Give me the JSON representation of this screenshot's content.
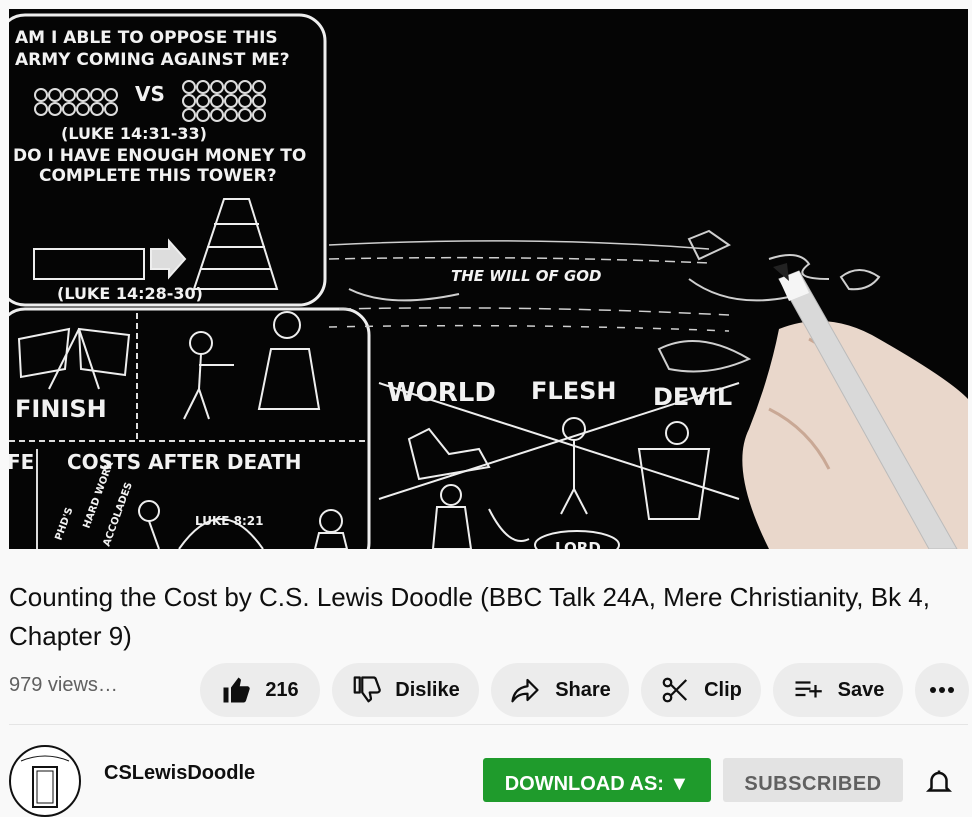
{
  "video": {
    "bubble_top_text1": "AM I ABLE TO OPPOSE THIS",
    "bubble_top_text2": "ARMY COMING AGAINST ME?",
    "bubble_vs": "VS",
    "bubble_top_ref": "(LUKE 14:31-33)",
    "bubble_mid_text1": "DO I HAVE ENOUGH MONEY TO",
    "bubble_mid_text2": "COMPLETE THIS TOWER?",
    "bubble_mid_ref": "(LUKE 14:28-30)",
    "finish_label": "FINISH",
    "costs_label": "COSTS AFTER DEATH",
    "river_label": "THE WILL OF GOD",
    "world_label": "WORLD",
    "flesh_label": "FLESH",
    "devil_label": "DEVIL",
    "lord_label": "LORD",
    "luke_label": "LUKE 8:21",
    "side_label_1": "PHD'S",
    "side_label_2": "HARD WORK",
    "side_label_3": "ACCOLADES",
    "edge_label": "FE"
  },
  "title": "Counting the Cost by C.S. Lewis Doodle (BBC Talk 24A, Mere Christianity, Bk 4, Chapter 9)",
  "views": "979 views…",
  "actions": {
    "like_count": "216",
    "dislike_label": "Dislike",
    "share_label": "Share",
    "clip_label": "Clip",
    "save_label": "Save"
  },
  "channel": {
    "name": "CSLewisDoodle",
    "download_label": "DOWNLOAD AS: ▼",
    "subscribed_label": "SUBSCRIBED",
    "download_color": "#1f9b2c"
  },
  "icons": [
    "thumbs-up-icon",
    "thumbs-down-icon",
    "share-icon",
    "scissors-icon",
    "playlist-add-icon",
    "more-icon",
    "bell-icon"
  ]
}
